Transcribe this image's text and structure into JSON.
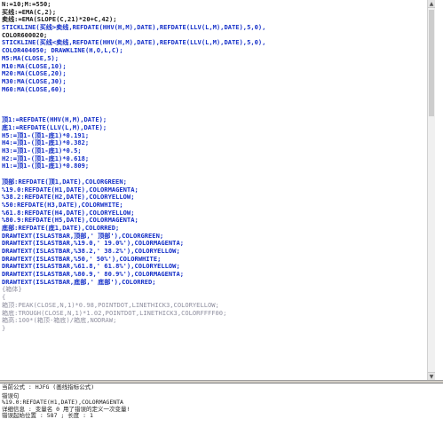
{
  "editor": {
    "lines": [
      {
        "text": "N:=10;M:=550;",
        "color": "black"
      },
      {
        "text": "买线:=EMA(C,2);",
        "color": "black"
      },
      {
        "text": "卖线:=EMA(SLOPE(C,21)*20+C,42);",
        "color": "black"
      },
      {
        "text": "STICKLINE(买线>卖线,REFDATE(HHV(H,M),DATE),REFDATE(LLV(L,M),DATE),5,0),",
        "color": "blue"
      },
      {
        "text": "COLOR600020;",
        "color": "black"
      },
      {
        "text": "STICKLINE(买线<卖线,REFDATE(HHV(H,M),DATE),REFDATE(LLV(L,M),DATE),5,0),",
        "color": "blue"
      },
      {
        "text": "COLOR404050; DRAWKLINE(H,O,L,C);",
        "color": "blue"
      },
      {
        "text": "M5:MA(CLOSE,5);",
        "color": "blue"
      },
      {
        "text": "M10:MA(CLOSE,10);",
        "color": "blue"
      },
      {
        "text": "M20:MA(CLOSE,20);",
        "color": "blue"
      },
      {
        "text": "M30:MA(CLOSE,30);",
        "color": "blue"
      },
      {
        "text": "M60:MA(CLOSE,60);",
        "color": "blue"
      },
      {
        "text": "",
        "color": "black"
      },
      {
        "text": "",
        "color": "black"
      },
      {
        "text": "",
        "color": "black"
      },
      {
        "text": "顶1:=REFDATE(HHV(H,M),DATE);",
        "color": "blue"
      },
      {
        "text": "底1:=REFDATE(LLV(L,M),DATE);",
        "color": "blue"
      },
      {
        "text": "H5:=顶1-(顶1-底1)*0.191;",
        "color": "blue"
      },
      {
        "text": "H4:=顶1-(顶1-底1)*0.382;",
        "color": "blue"
      },
      {
        "text": "H3:=顶1-(顶1-底1)*0.5;",
        "color": "blue"
      },
      {
        "text": "H2:=顶1-(顶1-底1)*0.618;",
        "color": "blue"
      },
      {
        "text": "H1:=顶1-(顶1-底1)*0.809;",
        "color": "blue"
      },
      {
        "text": "",
        "color": "black"
      },
      {
        "text": "顶部:REFDATE(顶1,DATE),COLORGREEN;",
        "color": "blue"
      },
      {
        "text": "%19.0:REFDATE(H1,DATE),COLORMAGENTA;",
        "color": "blue"
      },
      {
        "text": "%38.2:REFDATE(H2,DATE),COLORYELLOW;",
        "color": "blue"
      },
      {
        "text": "%50:REFDATE(H3,DATE),COLORWHITE;",
        "color": "blue"
      },
      {
        "text": "%61.8:REFDATE(H4,DATE),COLORYELLOW;",
        "color": "blue"
      },
      {
        "text": "%80.9:REFDATE(H5,DATE),COLORMAGENTA;",
        "color": "blue"
      },
      {
        "text": "底部:REFDATE(底1,DATE),COLORRED;",
        "color": "blue"
      },
      {
        "text": "DRAWTEXT(ISLASTBAR,顶部,' 顶部'),COLORGREEN;",
        "color": "blue"
      },
      {
        "text": "DRAWTEXT(ISLASTBAR,%19.0,' 19.0%'),COLORMAGENTA;",
        "color": "blue"
      },
      {
        "text": "DRAWTEXT(ISLASTBAR,%38.2,' 38.2%'),COLORYELLOW;",
        "color": "blue"
      },
      {
        "text": "DRAWTEXT(ISLASTBAR,%50,' 50%'),COLORWHITE;",
        "color": "blue"
      },
      {
        "text": "DRAWTEXT(ISLASTBAR,%61.8,' 61.8%'),COLORYELLOW;",
        "color": "blue"
      },
      {
        "text": "DRAWTEXT(ISLASTBAR,%80.9,' 80.9%'),COLORMAGENTA;",
        "color": "blue"
      },
      {
        "text": "DRAWTEXT(ISLASTBAR,底部,' 底部'),COLORRED;",
        "color": "blue"
      },
      {
        "text": "{箱体}",
        "color": "gray"
      },
      {
        "text": "{",
        "color": "gray"
      },
      {
        "text": "箱顶:PEAK(CLOSE,N,1)*0.98,POINTDOT,LINETHICK3,COLORYELLOW;",
        "color": "gray"
      },
      {
        "text": "箱底:TROUGH(CLOSE,N,1)*1.02,POINTDOT,LINETHICK3,COLORFFFF00;",
        "color": "gray"
      },
      {
        "text": "箱高:100*(箱顶-箱底)/箱底,NODRAW;",
        "color": "gray"
      },
      {
        "text": "}",
        "color": "gray"
      }
    ]
  },
  "status": {
    "current_formula": "当前公式 : HJFG (画线指标公式)",
    "error_title": "错误句",
    "error_statement": "%19.0:REFDATE(H1,DATE),COLORMAGENTA",
    "error_detail": "详细信息 : 变量名 0 用了错误的定义一次变量!",
    "error_position": "错误起始位置 : 587 ; 长度 : 1"
  },
  "scrollbar": {
    "up_glyph": "▲",
    "down_glyph": "▼"
  },
  "colors": {
    "black": "#1a1a1a",
    "blue": "#1530c8",
    "gray": "#9090a0"
  }
}
